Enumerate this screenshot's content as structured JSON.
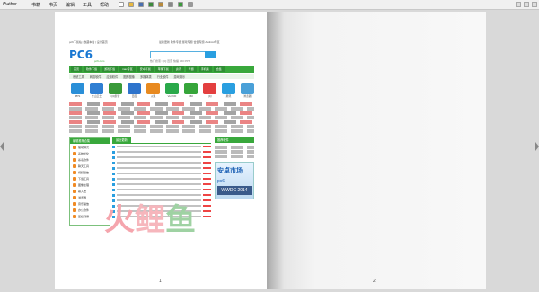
{
  "app": {
    "title": "iAuthor"
  },
  "menu": [
    "书籍",
    "书页",
    "编辑",
    "工具",
    "帮助"
  ],
  "toolbar_icons": [
    {
      "name": "new-doc-icon",
      "color": "#ffffff"
    },
    {
      "name": "open-icon",
      "color": "#e8b840"
    },
    {
      "name": "save-icon",
      "color": "#4a6fb0"
    },
    {
      "name": "undo-icon",
      "color": "#3c8b3c"
    },
    {
      "name": "edit-icon",
      "color": "#b88a3c"
    },
    {
      "name": "tool-icon",
      "color": "#888888"
    },
    {
      "name": "add-page-icon",
      "color": "#3c9b3c"
    },
    {
      "name": "settings-icon",
      "color": "#999999"
    }
  ],
  "pages": {
    "left_num": "1",
    "right_num": "2"
  },
  "site": {
    "logo": "PC6",
    "logo_sub": "pc6.com",
    "top_left": "pc6下载站  |  收藏本站  |  设为首页",
    "top_links": "最新更新  软件专题  游戏专题  合集专题  Android专区",
    "hotline": "热门搜索: QQ  迅雷  快播  360  PPS",
    "nav": [
      "首页",
      "软件下载",
      "游戏下载",
      "mac专区",
      "安卓下载",
      "苹果下载",
      "资讯",
      "专题",
      "手机版",
      "合集"
    ],
    "subnav": [
      "系统工具",
      "网络软件",
      "应用软件",
      "图形图像",
      "多媒体类",
      "行业软件",
      "游戏娱乐"
    ],
    "apps": [
      {
        "label": "PPS",
        "color": "#2a8fd8"
      },
      {
        "label": "金山卫士",
        "color": "#2f7fd3"
      },
      {
        "label": "QQ影音",
        "color": "#3a9a3a"
      },
      {
        "label": "百度",
        "color": "#2e74cc"
      },
      {
        "label": "火狐",
        "color": "#e88a20"
      },
      {
        "label": "VeryCD",
        "color": "#2aa94a"
      },
      {
        "label": "360",
        "color": "#36a53a"
      },
      {
        "label": "QQ",
        "color": "#e33f3f"
      },
      {
        "label": "腾讯",
        "color": "#2a9fe0"
      },
      {
        "label": "浏览器",
        "color": "#4aa0d8"
      }
    ],
    "left_head": "编辑推荐合集",
    "cats": [
      "驱动精灵",
      "系统优化",
      "杀毒软件",
      "聊天工具",
      "视频播放",
      "下载工具",
      "图像处理",
      "输入法",
      "浏览器",
      "音乐播放",
      "办公软件",
      "压缩刻录"
    ],
    "mid_head": "最近更新",
    "news_count": 14,
    "right_head": "推荐软件",
    "ad_title": "安卓市场",
    "ad_sub": "pc6",
    "ad_wwdc": "WWDC 2014"
  },
  "watermark": [
    {
      "char": "火",
      "color": "#f5a5ad"
    },
    {
      "char": "鲤",
      "color": "#f6b6bc"
    },
    {
      "char": "鱼",
      "color": "#9fd2a3"
    }
  ]
}
